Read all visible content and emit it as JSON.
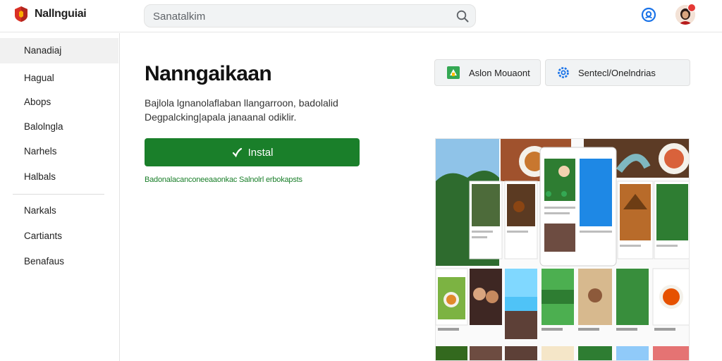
{
  "header": {
    "brand": "Nallnguiai",
    "search_placeholder": "Sanatalkim"
  },
  "sidebar": {
    "items": [
      {
        "label": "Nanadiaj"
      },
      {
        "label": "Hagual"
      },
      {
        "label": "Abops"
      },
      {
        "label": "Balolngla"
      },
      {
        "label": "Narhels"
      },
      {
        "label": "Halbals"
      },
      {
        "label": "Narkals"
      },
      {
        "label": "Cartiants"
      },
      {
        "label": "Benafaus"
      }
    ]
  },
  "app": {
    "title": "Nanngaikaan",
    "description": "Bajlola lgnanolaflaban llangarroon, badolalid Degpalcking|apala janaanal odiklir.",
    "install_label": "Instal",
    "install_note": "Badonalacanconeeaaonkac Salnolrl erbokapsts"
  },
  "actions": [
    {
      "label": "Aslon Mouaont",
      "icon": "app-icon"
    },
    {
      "label": "Sentecl/Onelndrias",
      "icon": "gear-icon"
    }
  ],
  "colors": {
    "accent_green": "#1a7f2a",
    "logo_red": "#d93025",
    "logo_yellow": "#f9ab00",
    "help_blue": "#1a73e8"
  }
}
